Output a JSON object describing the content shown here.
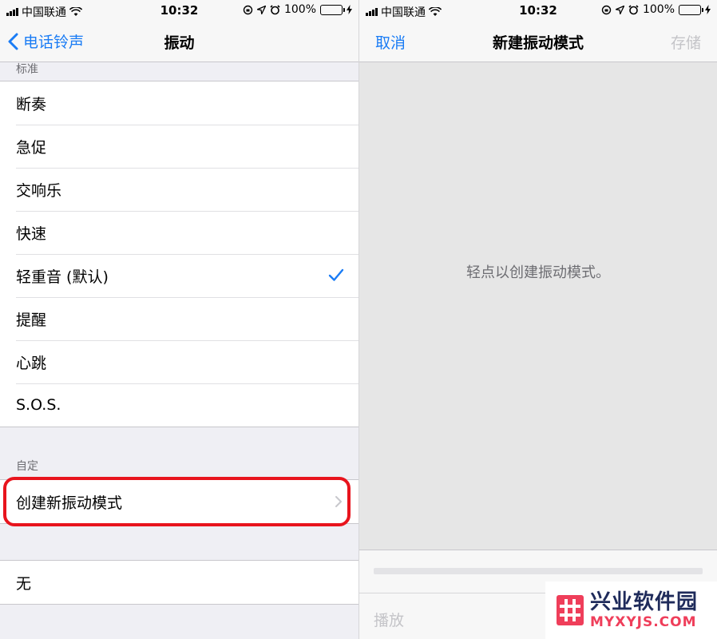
{
  "status": {
    "carrier": "中国联通",
    "time": "10:32",
    "battery": "100%"
  },
  "left": {
    "nav": {
      "back_label": "电话铃声",
      "title": "振动"
    },
    "standard_header": "标准",
    "standard_items": [
      {
        "label": "断奏"
      },
      {
        "label": "急促"
      },
      {
        "label": "交响乐"
      },
      {
        "label": "快速"
      },
      {
        "label": "轻重音 (默认)",
        "selected": true
      },
      {
        "label": "提醒"
      },
      {
        "label": "心跳"
      },
      {
        "label": "S.O.S."
      }
    ],
    "custom_header": "自定",
    "create_label": "创建新振动模式",
    "none_label": "无"
  },
  "right": {
    "nav": {
      "cancel_label": "取消",
      "title": "新建振动模式",
      "save_label": "存储"
    },
    "hint": "轻点以创建振动模式。",
    "play_label": "播放"
  },
  "watermark": {
    "cn": "兴业软件园",
    "en": "MYXYJS.COM"
  },
  "colors": {
    "accent": "#1a7cf5",
    "highlight": "#e8141d",
    "battery": "#4cd964"
  },
  "icons": [
    "signal-icon",
    "wifi-icon",
    "rotation-lock-icon",
    "location-icon",
    "alarm-icon",
    "battery-icon",
    "charging-icon",
    "back-chevron-icon",
    "checkmark-icon",
    "chevron-right-icon"
  ]
}
